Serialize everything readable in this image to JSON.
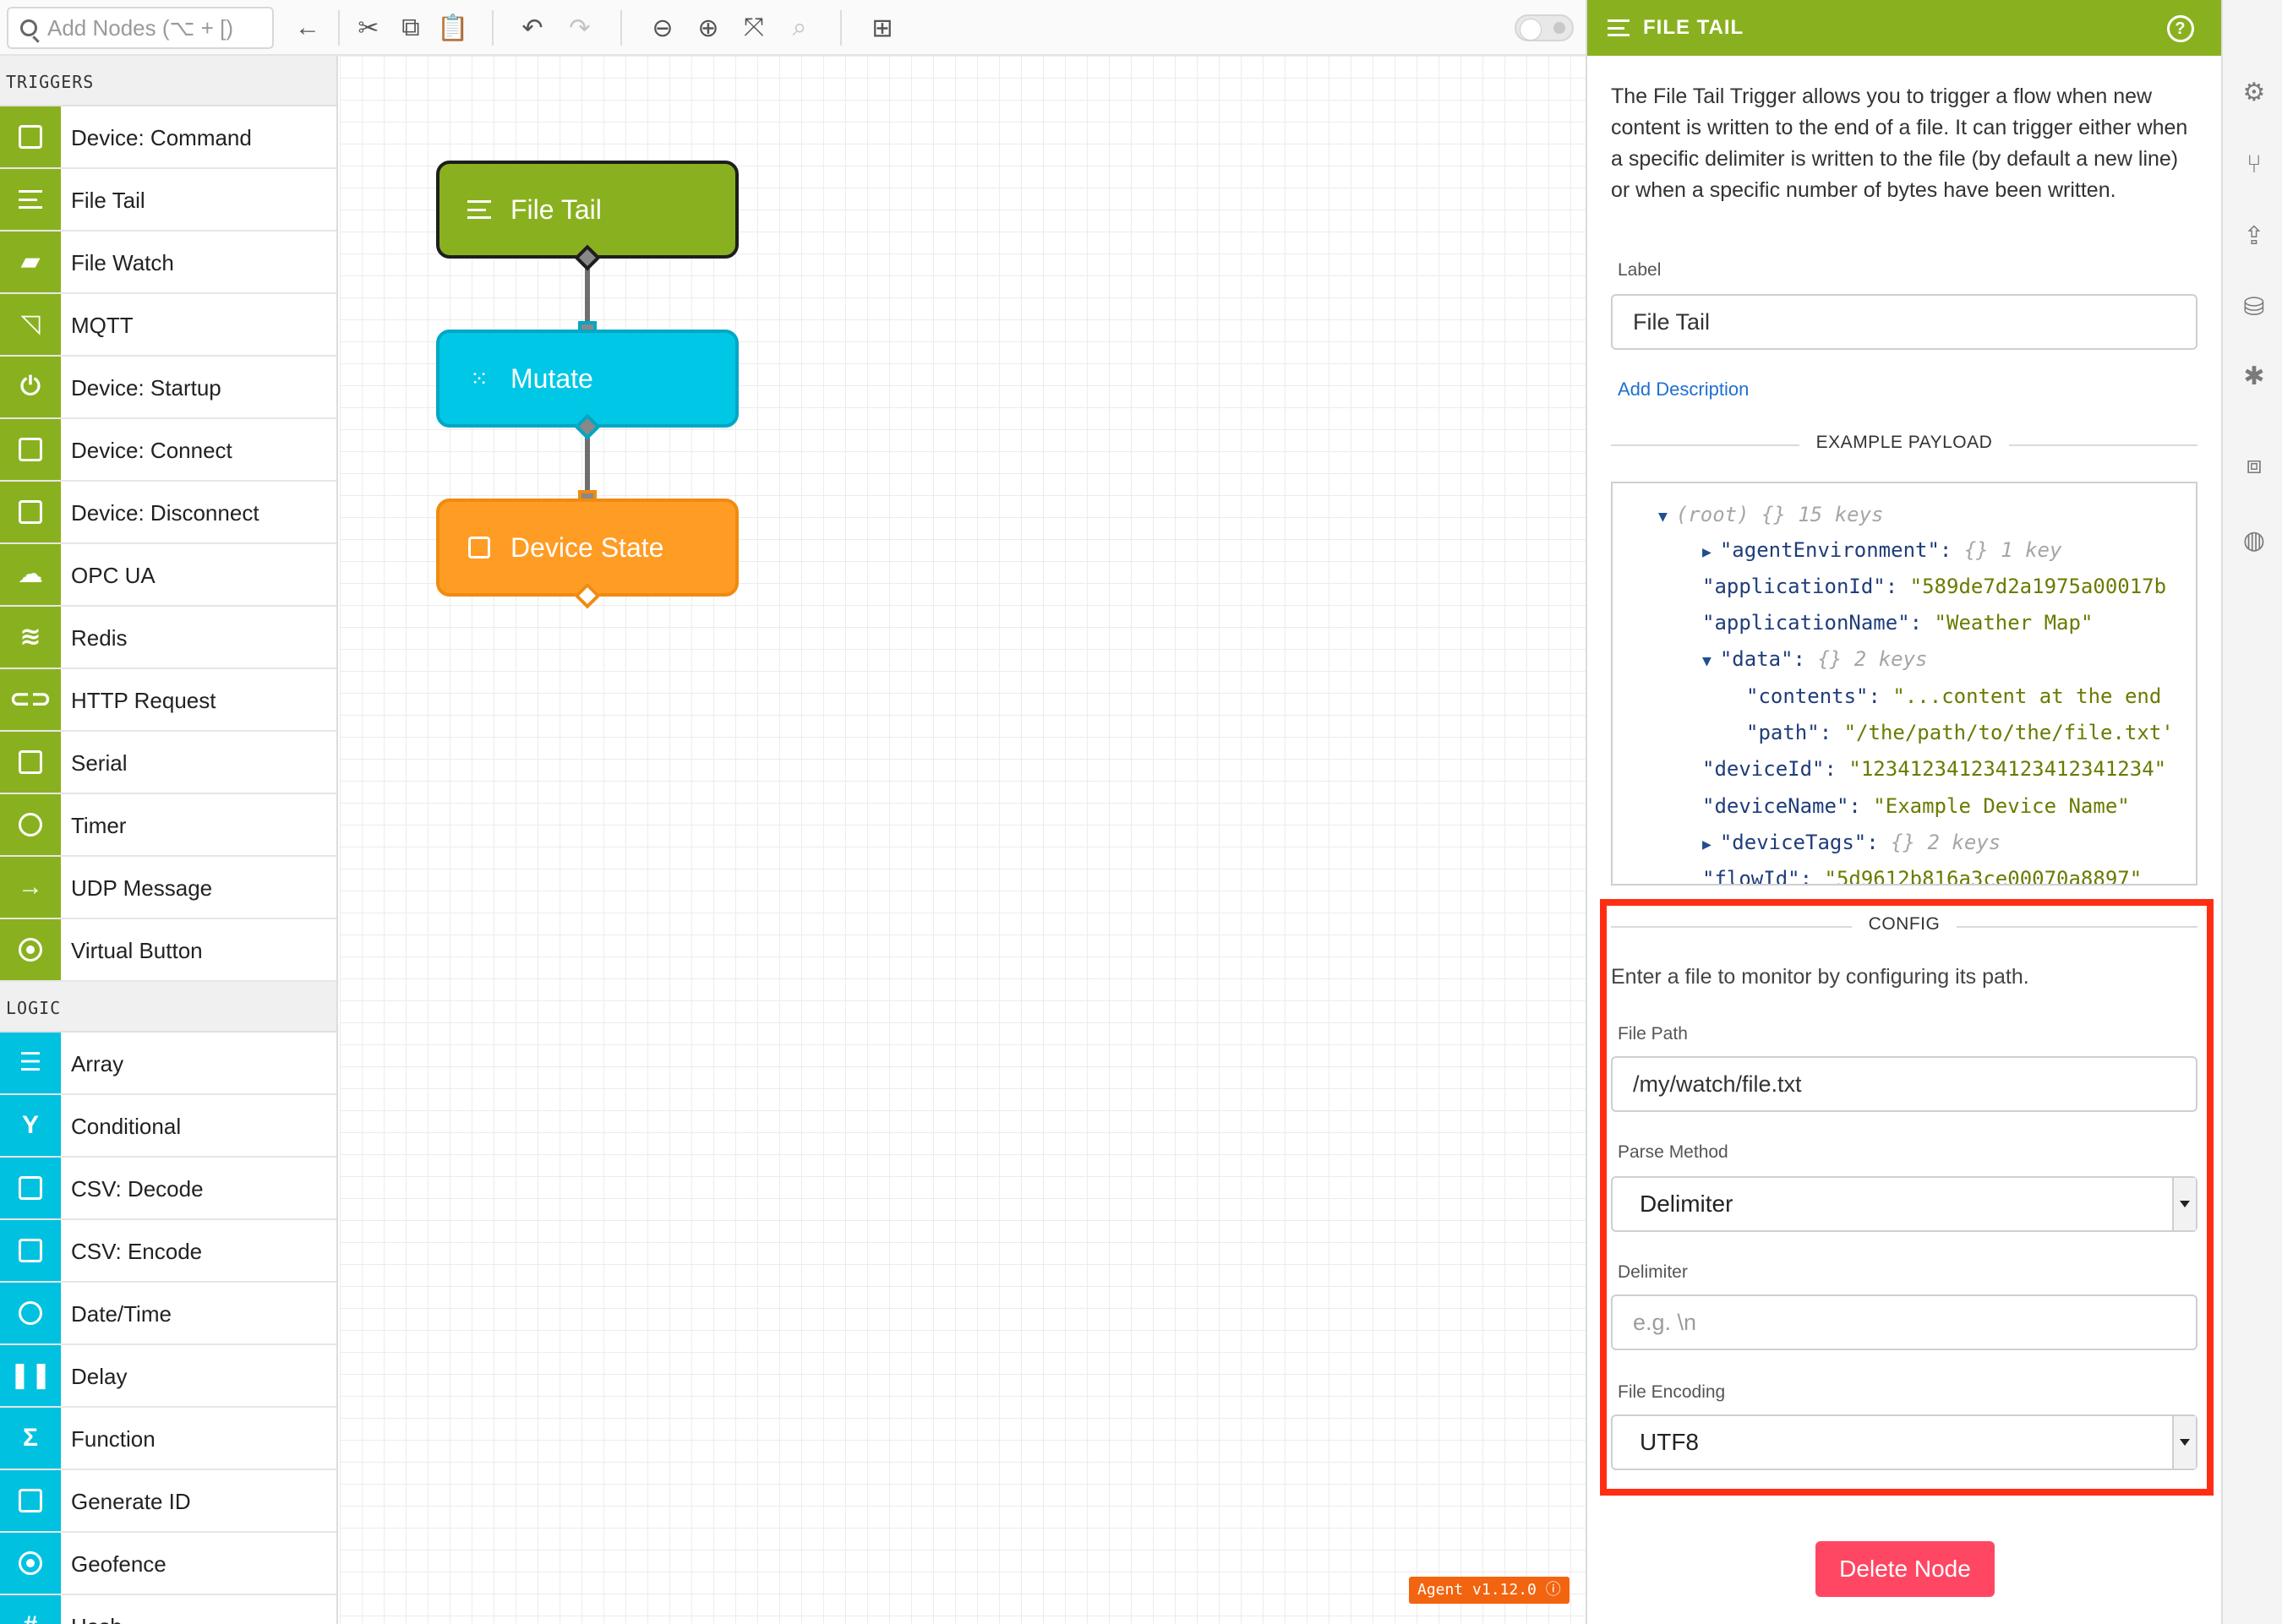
{
  "toolbar": {
    "search_placeholder": "Add Nodes (⌥ + [)",
    "icons": [
      "arrow-left-icon",
      "cut-icon",
      "copy-icon",
      "paste-icon",
      "undo-icon",
      "redo-icon",
      "zoom-out-icon",
      "zoom-in-icon",
      "fit-icon",
      "zoom-search-icon",
      "add-comment-icon",
      "debug-toggle"
    ]
  },
  "palette": {
    "triggers_title": "TRIGGERS",
    "triggers": [
      {
        "label": "Device: Command",
        "icon": "chip-icon"
      },
      {
        "label": "File Tail",
        "icon": "lines-icon"
      },
      {
        "label": "File Watch",
        "icon": "folder-plus-icon"
      },
      {
        "label": "MQTT",
        "icon": "rss-icon"
      },
      {
        "label": "Device: Startup",
        "icon": "power-icon"
      },
      {
        "label": "Device: Connect",
        "icon": "chip-icon"
      },
      {
        "label": "Device: Disconnect",
        "icon": "chip-icon"
      },
      {
        "label": "OPC UA",
        "icon": "cloud-upload-icon"
      },
      {
        "label": "Redis",
        "icon": "layers-icon"
      },
      {
        "label": "HTTP Request",
        "icon": "link-icon"
      },
      {
        "label": "Serial",
        "icon": "serial-icon"
      },
      {
        "label": "Timer",
        "icon": "stopwatch-icon"
      },
      {
        "label": "UDP Message",
        "icon": "arrow-right-icon"
      },
      {
        "label": "Virtual Button",
        "icon": "radio-icon"
      }
    ],
    "logic_title": "LOGIC",
    "logic": [
      {
        "label": "Array",
        "icon": "list-icon"
      },
      {
        "label": "Conditional",
        "icon": "branch-icon"
      },
      {
        "label": "CSV: Decode",
        "icon": "csv-icon"
      },
      {
        "label": "CSV: Encode",
        "icon": "csv-icon"
      },
      {
        "label": "Date/Time",
        "icon": "clock-icon"
      },
      {
        "label": "Delay",
        "icon": "pause-icon"
      },
      {
        "label": "Function",
        "icon": "sigma-icon"
      },
      {
        "label": "Generate ID",
        "icon": "id-card-icon"
      },
      {
        "label": "Geofence",
        "icon": "crosshair-icon"
      },
      {
        "label": "Hash",
        "icon": "hash-icon"
      }
    ]
  },
  "canvas": {
    "nodes": [
      {
        "label": "File Tail",
        "color": "#89b11f"
      },
      {
        "label": "Mutate",
        "color": "#00c7e6"
      },
      {
        "label": "Device State",
        "color": "#ff9c24"
      }
    ],
    "version": "Agent v1.12.0"
  },
  "panel": {
    "title": "FILE TAIL",
    "description": "The File Tail Trigger allows you to trigger a flow when new content is written to the end of a file. It can trigger either when a specific delimiter is written to the file (by default a new line) or when a specific number of bytes have been written.",
    "label_label": "Label",
    "label_value": "File Tail",
    "add_description": "Add Description",
    "example_payload_title": "EXAMPLE PAYLOAD",
    "payload": {
      "root": "(root)",
      "root_meta": "{} 15 keys",
      "agentEnvironment_key": "\"agentEnvironment\":",
      "agentEnvironment_meta": "{} 1 key",
      "applicationId_key": "\"applicationId\":",
      "applicationId_val": "\"589de7d2a1975a00017b",
      "applicationName_key": "\"applicationName\":",
      "applicationName_val": "\"Weather Map\"",
      "data_key": "\"data\":",
      "data_meta": "{} 2 keys",
      "contents_key": "\"contents\":",
      "contents_val": "\"...content at the end",
      "path_key": "\"path\":",
      "path_val": "\"/the/path/to/the/file.txt'",
      "deviceId_key": "\"deviceId\":",
      "deviceId_val": "\"123412341234123412341234\"",
      "deviceName_key": "\"deviceName\":",
      "deviceName_val": "\"Example Device Name\"",
      "deviceTags_key": "\"deviceTags\":",
      "deviceTags_meta": "{} 2 keys",
      "flowId_key": "\"flowId\":",
      "flowId_val": "\"5d9612b816a3ce00070a8897\""
    },
    "config_title": "CONFIG",
    "config_hint": "Enter a file to monitor by configuring its path.",
    "file_path_label": "File Path",
    "file_path_value": "/my/watch/file.txt",
    "parse_method_label": "Parse Method",
    "parse_method_value": "Delimiter",
    "delimiter_label": "Delimiter",
    "delimiter_placeholder": "e.g. \\n",
    "file_encoding_label": "File Encoding",
    "file_encoding_value": "UTF8",
    "delete_button": "Delete Node",
    "highlight_color": "#ff2e12"
  },
  "rail": {
    "icons": [
      "gear-icon",
      "branch-icon",
      "upload-icon",
      "database-icon",
      "bug-icon",
      "terminal-icon",
      "globe-icon"
    ]
  }
}
